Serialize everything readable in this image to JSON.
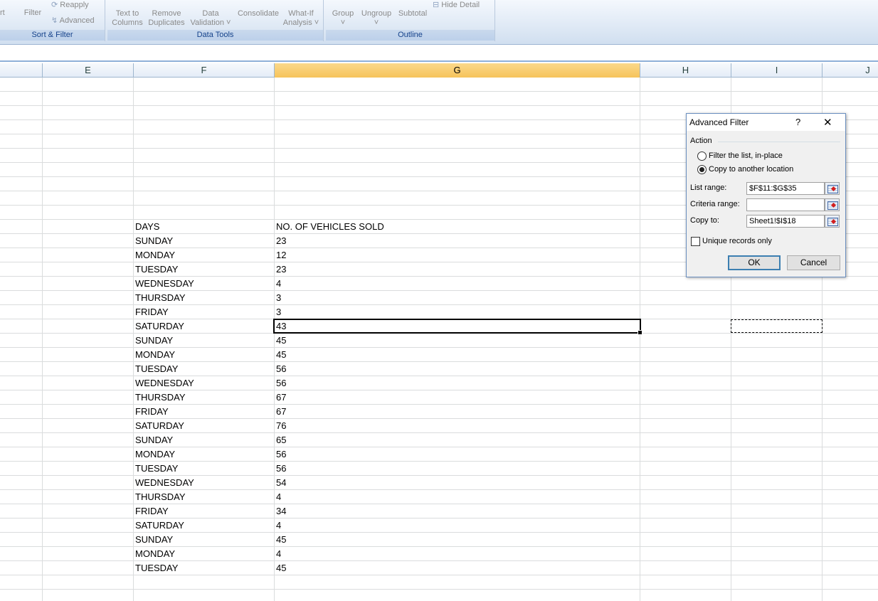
{
  "ribbon": {
    "sort_filter": {
      "partial_sort_label": "rt",
      "filter_label": "Filter",
      "reapply_label": "Reapply",
      "advanced_label": "Advanced",
      "group_label": "Sort & Filter"
    },
    "data_tools": {
      "text_to_columns_line1": "Text to",
      "text_to_columns_line2": "Columns",
      "remove_duplicates_line1": "Remove",
      "remove_duplicates_line2": "Duplicates",
      "data_validation_line1": "Data",
      "data_validation_line2": "Validation ˅",
      "consolidate_label": "Consolidate",
      "what_if_line1": "What-If",
      "what_if_line2": "Analysis ˅",
      "group_label": "Data Tools"
    },
    "outline": {
      "group_label_btn": "Group",
      "ungroup_label": "Ungroup",
      "subtotal_label": "Subtotal",
      "hide_detail_label": "Hide Detail",
      "group_label": "Outline"
    }
  },
  "columns": [
    "E",
    "F",
    "G",
    "H",
    "I",
    "J"
  ],
  "table": {
    "header_days": "DAYS",
    "header_vehicles": "NO. OF VEHICLES SOLD",
    "rows": [
      [
        "SUNDAY",
        "23"
      ],
      [
        "MONDAY",
        "12"
      ],
      [
        "TUESDAY",
        "23"
      ],
      [
        "WEDNESDAY",
        "4"
      ],
      [
        "THURSDAY",
        "3"
      ],
      [
        "FRIDAY",
        "3"
      ],
      [
        "SATURDAY",
        "43"
      ],
      [
        "SUNDAY",
        "45"
      ],
      [
        "MONDAY",
        "45"
      ],
      [
        "TUESDAY",
        "56"
      ],
      [
        "WEDNESDAY",
        "56"
      ],
      [
        "THURSDAY",
        "67"
      ],
      [
        "FRIDAY",
        "67"
      ],
      [
        "SATURDAY",
        "76"
      ],
      [
        "SUNDAY",
        "65"
      ],
      [
        "MONDAY",
        "56"
      ],
      [
        "TUESDAY",
        "56"
      ],
      [
        "WEDNESDAY",
        "54"
      ],
      [
        "THURSDAY",
        "4"
      ],
      [
        "FRIDAY",
        "34"
      ],
      [
        "SATURDAY",
        "4"
      ],
      [
        "SUNDAY",
        "45"
      ],
      [
        "MONDAY",
        "4"
      ],
      [
        "TUESDAY",
        "45"
      ]
    ]
  },
  "dialog": {
    "title": "Advanced Filter",
    "help_glyph": "?",
    "close_glyph": "✕",
    "action_label": "Action",
    "radio_filter_in_place": "Filter the list, in-place",
    "radio_copy_location": "Copy to another location",
    "list_range_label": "List range:",
    "list_range_value": "$F$11:$G$35",
    "criteria_range_label": "Criteria range:",
    "criteria_range_value": "",
    "copy_to_label": "Copy to:",
    "copy_to_value": "Sheet1!$I$18",
    "unique_records_label": "Unique records only",
    "ok_label": "OK",
    "cancel_label": "Cancel"
  }
}
